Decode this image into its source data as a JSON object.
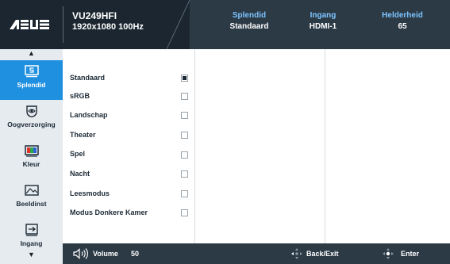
{
  "header": {
    "model": "VU249HFI",
    "resolution": "1920x1080 100Hz",
    "status": [
      {
        "key": "Splendid",
        "value": "Standaard"
      },
      {
        "key": "Ingang",
        "value": "HDMI-1"
      },
      {
        "key": "Helderheid",
        "value": "65"
      }
    ]
  },
  "sidebar": {
    "items": [
      {
        "label": "Splendid",
        "icon": "splendid-icon",
        "active": true
      },
      {
        "label": "Oogverzorging",
        "icon": "eye-icon",
        "active": false
      },
      {
        "label": "Kleur",
        "icon": "color-icon",
        "active": false
      },
      {
        "label": "Beeldinst",
        "icon": "image-icon",
        "active": false
      },
      {
        "label": "Ingang",
        "icon": "input-icon",
        "active": false
      }
    ]
  },
  "menu": {
    "options": [
      {
        "label": "Standaard",
        "selected": true
      },
      {
        "label": "sRGB",
        "selected": false
      },
      {
        "label": "Landschap",
        "selected": false
      },
      {
        "label": "Theater",
        "selected": false
      },
      {
        "label": "Spel",
        "selected": false
      },
      {
        "label": "Nacht",
        "selected": false
      },
      {
        "label": "Leesmodus",
        "selected": false
      },
      {
        "label": "Modus Donkere Kamer",
        "selected": false
      }
    ]
  },
  "footer": {
    "volume_label": "Volume",
    "volume_value": "50",
    "back_label": "Back/Exit",
    "enter_label": "Enter"
  },
  "colors": {
    "header_bg": "#2c3a46",
    "accent": "#1f8fe0",
    "status_key": "#7dc4ff"
  }
}
